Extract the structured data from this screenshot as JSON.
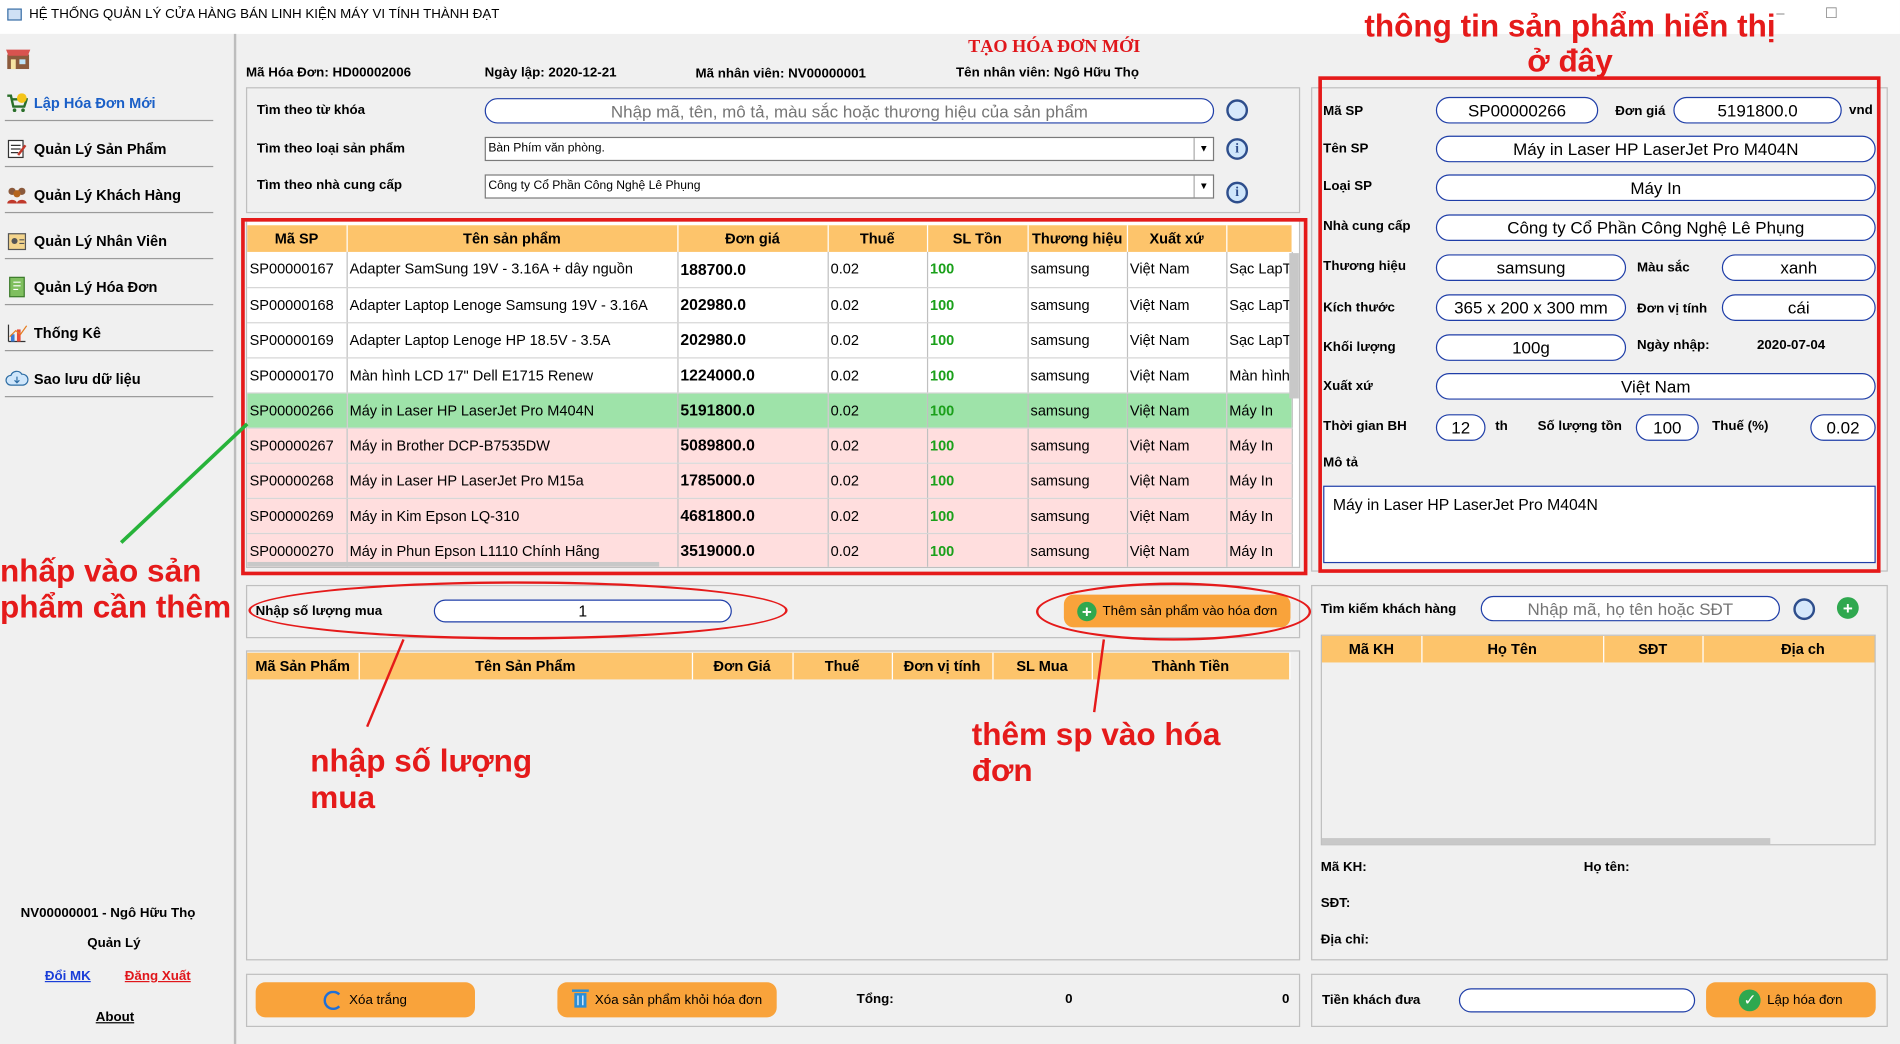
{
  "window": {
    "title": "HỆ THỐNG QUẢN LÝ CỬA HÀNG BÁN LINH KIỆN MÁY VI TÍNH THÀNH ĐẠT",
    "minimize": "–",
    "maximize": "☐"
  },
  "sidebar": {
    "items": [
      {
        "label": "Lập Hóa Đơn Mới",
        "icon": "cart-icon"
      },
      {
        "label": "Quản Lý Sản Phẩm",
        "icon": "product-icon"
      },
      {
        "label": "Quản Lý Khách Hàng",
        "icon": "customers-icon"
      },
      {
        "label": "Quản Lý Nhân Viên",
        "icon": "employee-icon"
      },
      {
        "label": "Quản Lý Hóa Đơn",
        "icon": "invoice-icon"
      },
      {
        "label": "Thống Kê",
        "icon": "chart-icon"
      },
      {
        "label": "Sao lưu dữ liệu",
        "icon": "backup-icon"
      }
    ],
    "user": "NV00000001 - Ngô Hữu  Thọ",
    "role": "Quản Lý",
    "change_password": "Đổi MK",
    "logout": "Đăng Xuất",
    "about": "About"
  },
  "header": {
    "title": "TẠO HÓA ĐƠN MỚI",
    "invoice_label": "Mã Hóa Đơn:",
    "invoice_value": "HD00002006",
    "date_label": "Ngày lập:",
    "date_value": "2020-12-21",
    "employee_id_label": "Mã nhân viên:",
    "employee_id_value": "NV00000001",
    "employee_name_label": "Tên nhân viên:",
    "employee_name_value": "Ngô Hữu  Thọ"
  },
  "search": {
    "keyword_label": "Tìm theo từ khóa",
    "keyword_placeholder": "Nhập mã, tên, mô tả, màu sắc hoặc thương hiệu của sản phẩm",
    "type_label": "Tìm theo loại sản phẩm",
    "type_value": "Bàn Phím văn phòng.",
    "supplier_label": "Tìm theo nhà cung cấp",
    "supplier_value": "Công ty Cổ Phần Công Nghệ Lê Phụng"
  },
  "products": {
    "columns": [
      "Mã SP",
      "Tên sản phẩm",
      "Đơn giá",
      "Thuế",
      "SL Tồn",
      "Thương hiệu",
      "Xuất xứ",
      ""
    ],
    "rows": [
      [
        "SP00000167",
        "Adapter SamSung 19V - 3.16A + dây nguồn",
        "188700.0",
        "0.02",
        "100",
        "samsung",
        "Việt Nam",
        "Sạc LapTop"
      ],
      [
        "SP00000168",
        "Adapter Laptop Lenoge Samsung 19V - 3.16A",
        "202980.0",
        "0.02",
        "100",
        "samsung",
        "Việt Nam",
        "Sạc LapTop"
      ],
      [
        "SP00000169",
        "Adapter Laptop Lenoge HP 18.5V - 3.5A",
        "202980.0",
        "0.02",
        "100",
        "samsung",
        "Việt Nam",
        "Sạc LapTop"
      ],
      [
        "SP00000170",
        "Màn hình LCD 17\" Dell E1715 Renew",
        "1224000.0",
        "0.02",
        "100",
        "samsung",
        "Việt Nam",
        "Màn hình"
      ],
      [
        "SP00000266",
        "Máy in Laser HP LaserJet Pro M404N",
        "5191800.0",
        "0.02",
        "100",
        "samsung",
        "Việt Nam",
        "Máy In"
      ],
      [
        "SP00000267",
        "Máy in Brother DCP-B7535DW",
        "5089800.0",
        "0.02",
        "100",
        "samsung",
        "Việt Nam",
        "Máy In"
      ],
      [
        "SP00000268",
        "Máy in Laser HP LaserJet Pro M15a",
        "1785000.0",
        "0.02",
        "100",
        "samsung",
        "Việt Nam",
        "Máy In"
      ],
      [
        "SP00000269",
        "Máy in Kim Epson LQ-310",
        "4681800.0",
        "0.02",
        "100",
        "samsung",
        "Việt Nam",
        "Máy In"
      ],
      [
        "SP00000270",
        "Máy in Phun Epson L1110 Chính Hãng",
        "3519000.0",
        "0.02",
        "100",
        "samsung",
        "Việt Nam",
        "Máy In"
      ]
    ],
    "selected_index": 4
  },
  "quantity": {
    "label": "Nhập số lượng mua",
    "value": "1"
  },
  "add_button": "Thêm sản phẩm vào hóa đơn",
  "invoice_table": {
    "columns": [
      "Mã Sản Phẩm",
      "Tên Sản Phẩm",
      "Đơn Giá",
      "Thuế",
      "Đơn vị tính",
      "SL Mua",
      "Thành Tiền"
    ]
  },
  "footer": {
    "clear": "Xóa trắng",
    "remove": "Xóa sản phẩm khỏi hóa đơn",
    "total_label": "Tổng:",
    "total_value1": "0",
    "total_value2": "0"
  },
  "detail": {
    "ma_sp_label": "Mã SP",
    "ma_sp": "SP00000266",
    "don_gia_label": "Đơn giá",
    "don_gia": "5191800.0",
    "unit": "vnd",
    "ten_sp_label": "Tên SP",
    "ten_sp": "Máy in Laser HP LaserJet Pro M404N",
    "loai_label": "Loại SP",
    "loai": "Máy In",
    "ncc_label": "Nhà cung cấp",
    "ncc": "Công ty Cổ Phần Công Nghệ Lê Phụng",
    "th_label": "Thương hiệu",
    "th": "samsung",
    "mau_label": "Màu sắc",
    "mau": "xanh",
    "kt_label": "Kích thước",
    "kt": "365 x 200 x 300 mm",
    "dvt_label": "Đơn vị tính",
    "dvt": "cái",
    "kl_label": "Khối lượng",
    "kl": "100g",
    "ngay_label": "Ngày nhập:",
    "ngay": "2020-07-04",
    "xx_label": "Xuất xứ",
    "xx": "Việt Nam",
    "bh_label": "Thời gian BH",
    "bh": "12",
    "bh_unit": "th",
    "slt_label": "Số lượng tồn",
    "slt": "100",
    "thue_label": "Thuế (%)",
    "thue": "0.02",
    "mota_label": "Mô tả",
    "mota": "Máy in Laser HP LaserJet Pro M404N"
  },
  "customer": {
    "search_label": "Tìm kiếm khách hàng",
    "search_placeholder": "Nhập mã, họ tên hoặc SĐT",
    "columns": [
      "Mã KH",
      "Họ Tên",
      "SĐT",
      "Địa ch"
    ],
    "ma_kh_label": "Mã KH:",
    "ho_ten_label": "Họ tên:",
    "sdt_label": "SĐT:",
    "dia_chi_label": "Địa chỉ:",
    "tien_label": "Tiền khách đưa",
    "create_button": "Lập hóa đơn"
  },
  "annotations": {
    "top_right": "thông tin sản phẩm hiển thị\nở đây",
    "left": "nhấp vào sản\nphẩm cần thêm",
    "qty": "nhập số lượng\nmua",
    "add": "thêm sp vào hóa\nđơn"
  },
  "colors": {
    "accent": "#fdc46b",
    "button": "#f9a33b",
    "selected_row": "#9ee3a9",
    "pink_row": "#ffdede",
    "annotation": "#e51a1a",
    "input_border": "#1f3ea8"
  }
}
